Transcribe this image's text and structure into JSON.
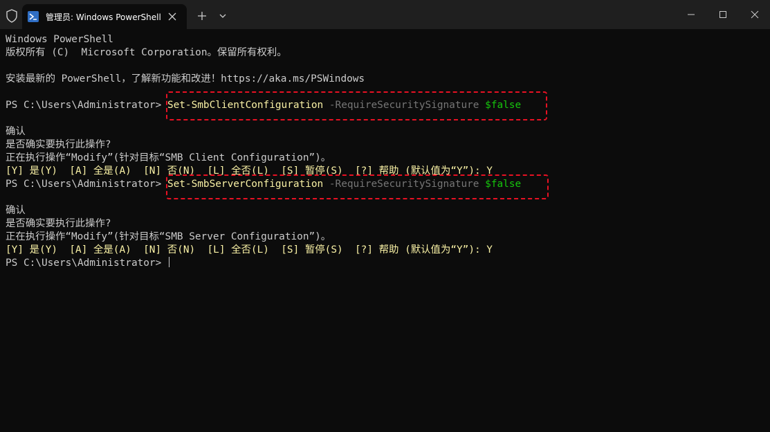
{
  "titlebar": {
    "tab_title": "管理员: Windows PowerShell",
    "new_tab_glyph": "+",
    "icons": [
      "shield-icon",
      "powershell-icon",
      "close-icon",
      "plus-icon",
      "chevron-down-icon",
      "minimize-icon",
      "maximize-icon",
      "close-window-icon"
    ]
  },
  "terminal": {
    "header_line1": "Windows PowerShell",
    "header_line2": "版权所有 (C)  Microsoft Corporation。保留所有权利。",
    "header_line3": "安装最新的 PowerShell，了解新功能和改进！https://aka.ms/PSWindows",
    "prompt": "PS C:\\Users\\Administrator> ",
    "command1": {
      "cmdlet": "Set-SmbClientConfiguration",
      "param": "-RequireSecuritySignature",
      "value": "$false"
    },
    "confirm1": {
      "title": "确认",
      "question": "是否确实要执行此操作?",
      "action": "正在执行操作“Modify”(针对目标“SMB Client Configuration”)。",
      "choices": "[Y] 是(Y)  [A] 全是(A)  [N] 否(N)  [L] 全否(L)  [S] 暂停(S)  [?] 帮助 (默认值为“Y”): Y"
    },
    "command2": {
      "cmdlet": "Set-SmbServerConfiguration",
      "param": "-RequireSecuritySignature",
      "value": "$false"
    },
    "confirm2": {
      "title": "确认",
      "question": "是否确实要执行此操作?",
      "action": "正在执行操作“Modify”(针对目标“SMB Server Configuration”)。",
      "choices": "[Y] 是(Y)  [A] 全是(A)  [N] 否(N)  [L] 全否(L)  [S] 暂停(S)  [?] 帮助 (默认值为“Y”): Y"
    },
    "final_prompt": "PS C:\\Users\\Administrator> "
  },
  "colors": {
    "background": "#0c0c0c",
    "titlebar": "#1f1f1f",
    "text": "#cccccc",
    "cmdlet": "#f9f1a5",
    "param": "#767676",
    "value": "#16c60c",
    "highlight": "#e81123"
  }
}
